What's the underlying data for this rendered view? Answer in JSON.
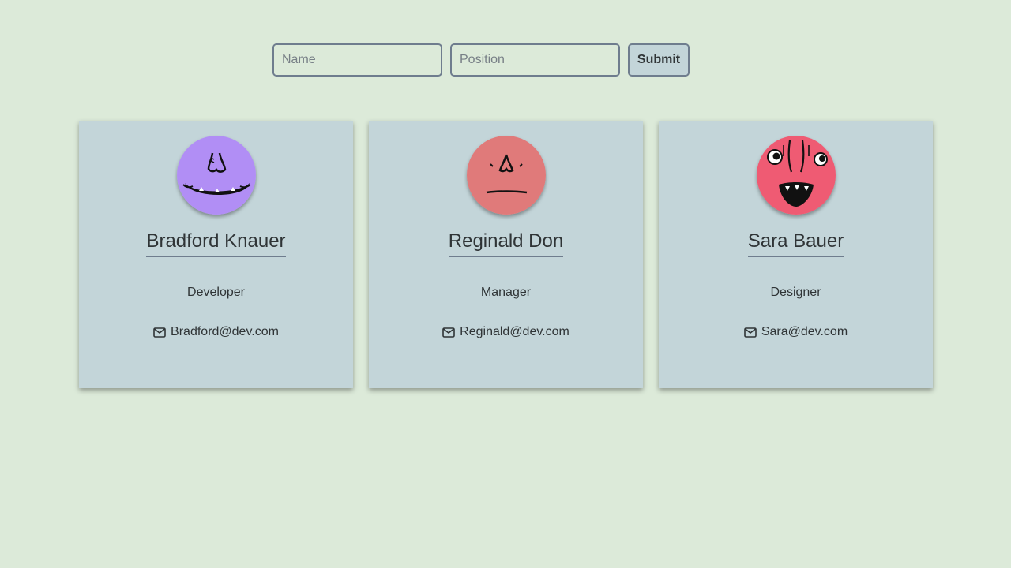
{
  "form": {
    "name_placeholder": "Name",
    "position_placeholder": "Position",
    "submit_label": "Submit"
  },
  "cards": [
    {
      "name": "Bradford Knauer",
      "position": "Developer",
      "email": "Bradford@dev.com",
      "avatar_color": "#b18ef5",
      "avatar_icon": "monster-grin-icon"
    },
    {
      "name": "Reginald Don",
      "position": "Manager",
      "email": "Reginald@dev.com",
      "avatar_color": "#e07a7a",
      "avatar_icon": "monster-neutral-icon"
    },
    {
      "name": "Sara Bauer",
      "position": "Designer",
      "email": "Sara@dev.com",
      "avatar_color": "#ef5b73",
      "avatar_icon": "monster-shout-icon"
    }
  ],
  "colors": {
    "background": "#dcead9",
    "card": "#c3d5d9",
    "border": "#6f7d8e",
    "text": "#2f3436"
  }
}
